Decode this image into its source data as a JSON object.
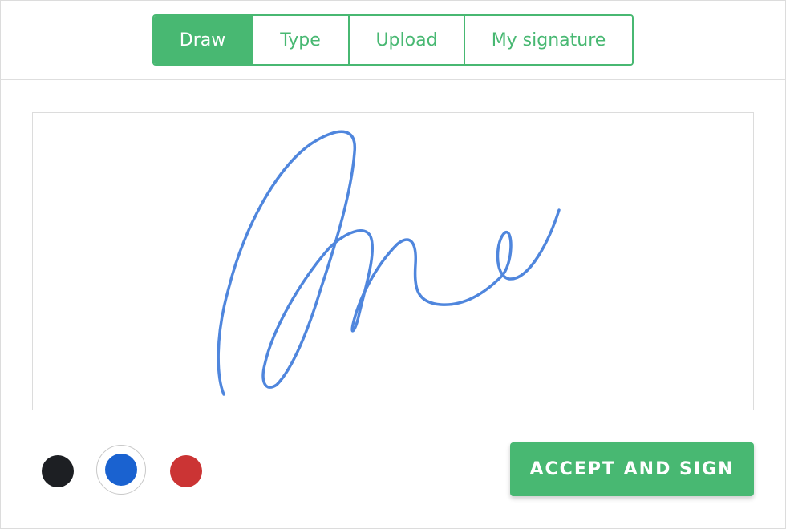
{
  "tabs": [
    {
      "label": "Draw",
      "active": true
    },
    {
      "label": "Type",
      "active": false
    },
    {
      "label": "Upload",
      "active": false
    },
    {
      "label": "My signature",
      "active": false
    }
  ],
  "colors": {
    "accent": "#48b872",
    "ink_options": [
      {
        "name": "black",
        "hex": "#1d1f23",
        "selected": false
      },
      {
        "name": "blue",
        "hex": "#1a62d0",
        "selected": true
      },
      {
        "name": "red",
        "hex": "#cb3434",
        "selected": false
      }
    ],
    "stroke": "#4f86dd"
  },
  "actions": {
    "accept_label": "ACCEPT AND SIGN"
  }
}
